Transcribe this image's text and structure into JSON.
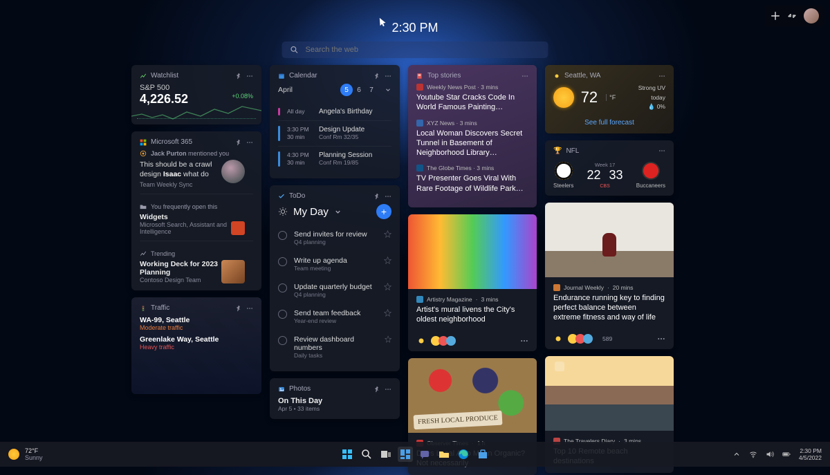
{
  "clock": "2:30 PM",
  "search": {
    "placeholder": "Search the web"
  },
  "watchlist": {
    "title": "Watchlist",
    "symbol": "S&P 500",
    "value": "4,226.52",
    "change": "+0.08%"
  },
  "m365": {
    "title": "Microsoft 365",
    "mention": {
      "user": "Jack Purton",
      "suffix": "mentioned you"
    },
    "quote_pre": "This should be a crawl design ",
    "quote_link": "Isaac",
    "quote_post": " what do",
    "quote_source": "Team Weekly Sync",
    "freq_label": "You frequently open this",
    "freq_title": "Widgets",
    "freq_sub": "Microsoft Search, Assistant and Intelligence",
    "trend_label": "Trending",
    "trend_title": "Working Deck for 2023 Planning",
    "trend_sub": "Contoso Design Team"
  },
  "traffic": {
    "title": "Traffic",
    "routes": [
      {
        "name": "WA-99, Seattle",
        "status": "Moderate traffic",
        "cls": "m"
      },
      {
        "name": "Greenlake Way, Seattle",
        "status": "Heavy traffic",
        "cls": "h"
      }
    ]
  },
  "calendar": {
    "title": "Calendar",
    "month": "April",
    "days": [
      {
        "n": "5",
        "sel": true
      },
      {
        "n": "6",
        "sel": false
      },
      {
        "n": "7",
        "sel": false
      }
    ],
    "events": [
      {
        "time1": "All day",
        "time2": "",
        "title": "Angela's Birthday",
        "loc": "",
        "bar": "1"
      },
      {
        "time1": "3:30 PM",
        "time2": "30 min",
        "title": "Design Update",
        "loc": "Conf Rm 32/35",
        "bar": "2"
      },
      {
        "time1": "4:30 PM",
        "time2": "30 min",
        "title": "Planning Session",
        "loc": "Conf Rm 19/85",
        "bar": "2"
      }
    ]
  },
  "todo": {
    "title": "ToDo",
    "list_name": "My Day",
    "items": [
      {
        "t": "Send invites for review",
        "s": "Q4 planning"
      },
      {
        "t": "Write up agenda",
        "s": "Team meeting"
      },
      {
        "t": "Update quarterly budget",
        "s": "Q4 planning"
      },
      {
        "t": "Send team feedback",
        "s": "Year-end review"
      },
      {
        "t": "Review dashboard numbers",
        "s": "Daily tasks"
      }
    ]
  },
  "photos": {
    "title": "Photos",
    "heading": "On This Day",
    "sub": "Apr 5  •  33 items"
  },
  "topstories": {
    "title": "Top stories",
    "items": [
      {
        "src": "Weekly News Post",
        "age": "3 mins",
        "hl": "Youtube Star Cracks Code In World Famous Painting…",
        "c": "#b33"
      },
      {
        "src": "XYZ News",
        "age": "3 mins",
        "hl": "Local Woman Discovers Secret Tunnel in Basement of Neighborhood Library…",
        "c": "#36a"
      },
      {
        "src": "The Globe Times",
        "age": "3 mins",
        "hl": "TV Presenter Goes Viral With Rare Footage of Wildlife Park…",
        "c": "#158"
      }
    ]
  },
  "weather": {
    "title": "Seattle, WA",
    "temp": "72",
    "unit": "°F",
    "cond1": "Strong UV today",
    "cond2": "0%",
    "link": "See full forecast"
  },
  "nfl": {
    "title": "NFL",
    "week": "Week 17",
    "network": "CBS",
    "team1": {
      "name": "Steelers",
      "score": "22"
    },
    "team2": {
      "name": "Buccaneers",
      "score": "33"
    }
  },
  "news_cards": {
    "mural": {
      "src": "Artistry Magazine",
      "age": "3 mins",
      "hl": "Artist's mural livens the City's oldest neighborhood"
    },
    "runner": {
      "src": "Journal Weekly",
      "age": "20 mins",
      "hl": "Endurance running key to finding perfect balance between extreme fitness and way of life",
      "count": "589"
    },
    "produce": {
      "src": "Observer Times",
      "age": "1 h",
      "hl": "Does Local Also Mean Organic? Not necessarily",
      "fresh": "FRESH LOCAL PRODUCE"
    },
    "beach": {
      "src": "The Travelers Diary",
      "age": "3 mins",
      "hl": "Top 10 Remote beach destinations"
    }
  },
  "taskbar": {
    "weather_temp": "72°F",
    "weather_cond": "Sunny",
    "time": "2:30 PM",
    "date": "4/5/2022"
  }
}
